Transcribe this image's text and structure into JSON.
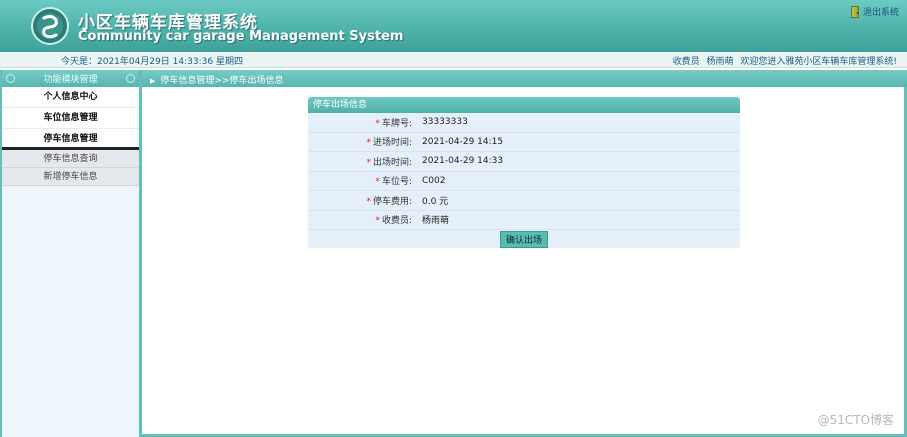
{
  "header": {
    "title_cn": "小区车辆车库管理系统",
    "title_en": "Community car garage Management System",
    "logout_label": "退出系统"
  },
  "infobar": {
    "date_text": "今天是：2021年04月29日  14:33:36  星期四",
    "role": "收费员",
    "user": "杨雨萌",
    "welcome": "欢迎您进入雅苑小区车辆车库管理系统!"
  },
  "sidebar": {
    "header": "功能模块管理",
    "menus": [
      {
        "label": "个人信息中心"
      },
      {
        "label": "车位信息管理"
      },
      {
        "label": "停车信息管理"
      }
    ],
    "sub_items": [
      {
        "label": "停车信息查询"
      },
      {
        "label": "新增停车信息"
      }
    ]
  },
  "breadcrumb": "停车信息管理>>停车出场信息",
  "form": {
    "title": "停车出场信息",
    "rows": [
      {
        "label": "车牌号:",
        "value": "33333333"
      },
      {
        "label": "进场时间:",
        "value": "2021-04-29 14:15"
      },
      {
        "label": "出场时间:",
        "value": "2021-04-29 14:33"
      },
      {
        "label": "车位号:",
        "value": "C002"
      },
      {
        "label": "停车费用:",
        "value": "0.0 元"
      },
      {
        "label": "收费员:",
        "value": "杨雨萌"
      }
    ],
    "submit_label": "确认出场"
  },
  "watermark": "@51CTO博客",
  "colors": {
    "accent": "#56b6ae",
    "panel_bg": "#e5effa",
    "required": "#e02020"
  }
}
